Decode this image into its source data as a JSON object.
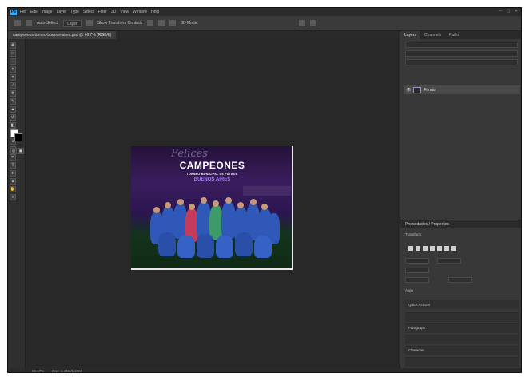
{
  "app": {
    "logo": "Ps",
    "menu": [
      "File",
      "Edit",
      "Image",
      "Layer",
      "Type",
      "Select",
      "Filter",
      "3D",
      "View",
      "Window",
      "Help"
    ],
    "window_controls": [
      "—",
      "▢",
      "✕"
    ]
  },
  "options_bar": {
    "items": [
      "Auto-Select:",
      "Layer",
      "Show Transform Controls",
      "3D Mode:"
    ]
  },
  "document": {
    "tab_title": "campeones-torneo-buenos-aires.psd @ 66.7% (RGB/8)"
  },
  "artwork": {
    "script": "Felices",
    "title": "CAMPEONES",
    "subtitle": "TORNEO MUNICIPAL DE FÚTBOL",
    "city": "BUENOS AIRES"
  },
  "panels": {
    "tabs": [
      "Layers",
      "Channels",
      "Paths"
    ],
    "layer_name": "Fondo",
    "properties_title": "Propiedades / Properties",
    "sections": [
      "Transform",
      "Align",
      "Quick Actions",
      "Paragraph",
      "Character"
    ]
  },
  "status": {
    "zoom": "66.67%",
    "doc_info": "Doc: 1.43M/1.43M"
  },
  "colors": {
    "accent": "#31a8ff",
    "canvas_bg": "#282828",
    "panel_bg": "#383838"
  }
}
